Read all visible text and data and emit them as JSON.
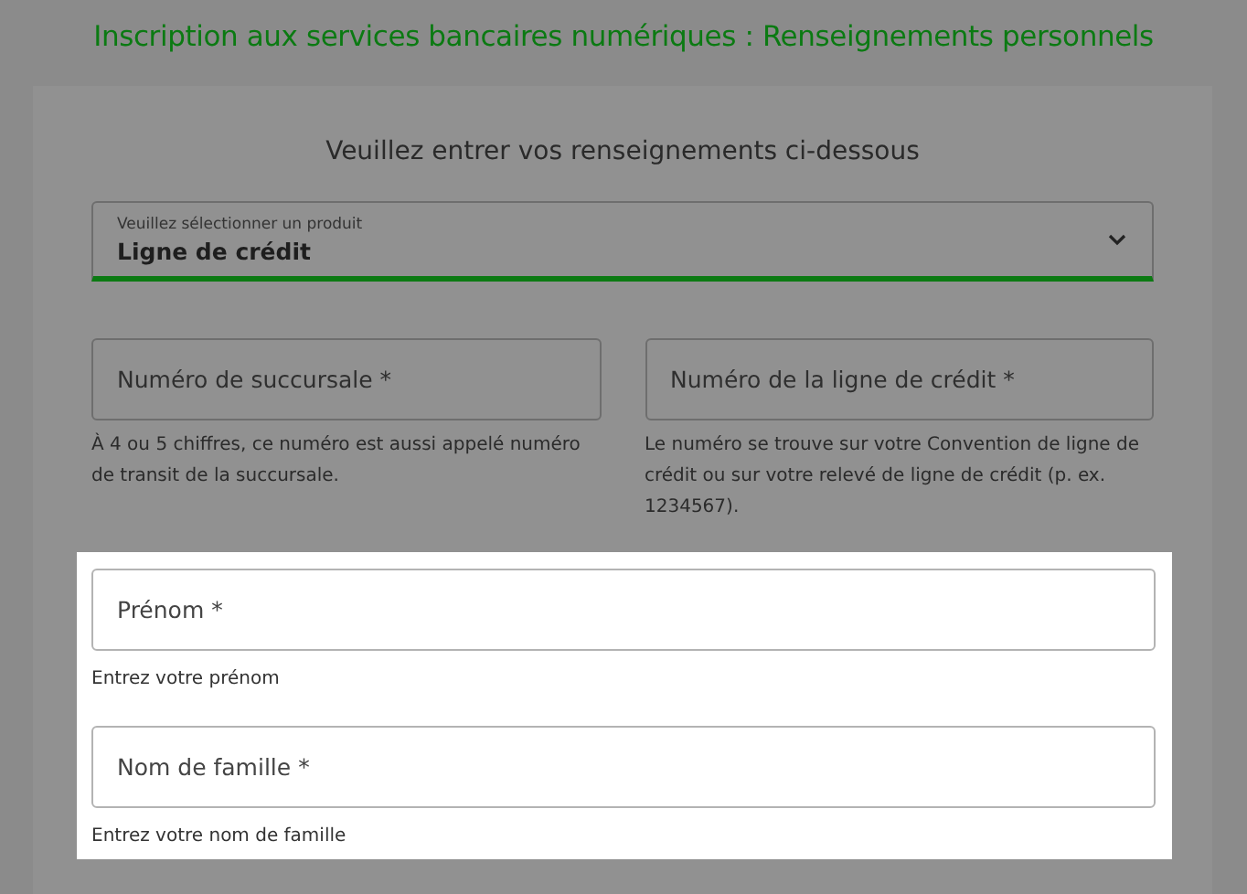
{
  "title": "Inscription aux services bancaires numériques : Renseignements personnels",
  "subtitle": "Veuillez entrer vos renseignements ci-dessous",
  "product_select": {
    "label": "Veuillez sélectionner un produit",
    "value": "Ligne de crédit"
  },
  "groups": [
    {
      "highlighted": false,
      "fields": [
        {
          "placeholder": "Numéro de succursale *",
          "help": "À 4 ou 5 chiffres, ce numéro est aussi appelé numéro de transit de la succursale."
        },
        {
          "placeholder": "Numéro de la ligne de crédit *",
          "help": "Le numéro se trouve sur votre Convention de ligne de crédit ou sur votre relevé de ligne de crédit (p. ex. 1234567)."
        }
      ]
    },
    {
      "highlighted": true,
      "fields": [
        {
          "placeholder": "Prénom *",
          "help": "Entrez votre prénom"
        }
      ]
    },
    {
      "highlighted": true,
      "fields": [
        {
          "placeholder": "Nom de famille *",
          "help": "Entrez votre nom de famille"
        }
      ]
    }
  ]
}
